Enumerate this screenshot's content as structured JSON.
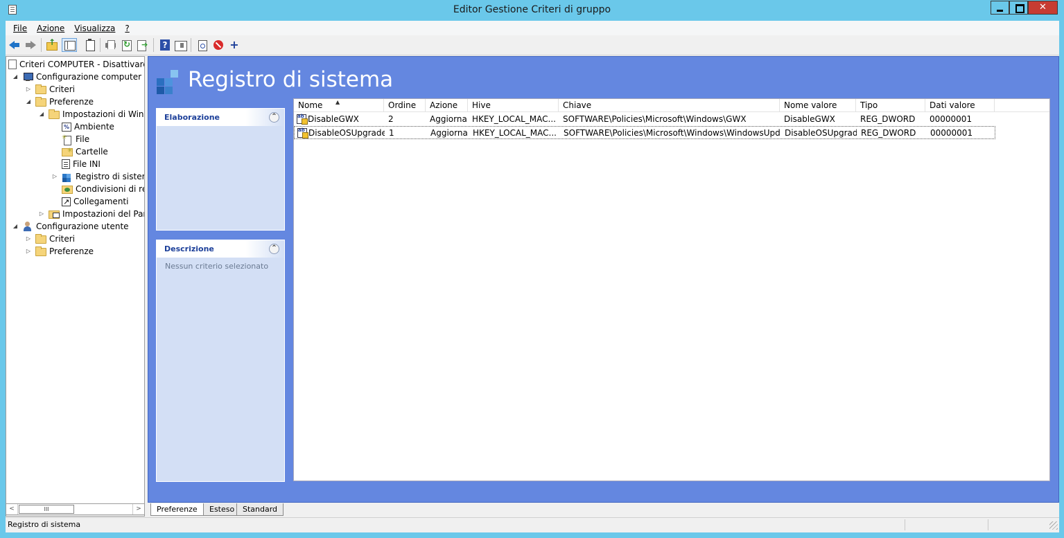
{
  "window": {
    "title": "Editor Gestione Criteri di gruppo"
  },
  "menu": {
    "items": [
      "File",
      "Azione",
      "Visualizza",
      "?"
    ]
  },
  "toolbar": {
    "icons": [
      "back-arrow",
      "forward-arrow",
      "folder-up",
      "show-tree",
      "clipboard",
      "print",
      "refresh",
      "export-list",
      "help",
      "action-pane",
      "new-item",
      "stop",
      "add"
    ]
  },
  "tree": {
    "items": [
      {
        "label": "Criteri COMPUTER - Disattivare I",
        "icon": "policy-doc"
      },
      {
        "label": "Configurazione computer",
        "icon": "computer"
      },
      {
        "label": "Criteri",
        "icon": "folder"
      },
      {
        "label": "Preferenze",
        "icon": "folder"
      },
      {
        "label": "Impostazioni di Windo",
        "icon": "folder"
      },
      {
        "label": "Ambiente",
        "icon": "environment"
      },
      {
        "label": "File",
        "icon": "file"
      },
      {
        "label": "Cartelle",
        "icon": "folder-new"
      },
      {
        "label": "File INI",
        "icon": "ini-file"
      },
      {
        "label": "Registro di sistema",
        "icon": "registry"
      },
      {
        "label": "Condivisioni di ret",
        "icon": "network-share"
      },
      {
        "label": "Collegamenti",
        "icon": "shortcut"
      },
      {
        "label": "Impostazioni del Panr",
        "icon": "control-panel"
      },
      {
        "label": "Configurazione utente",
        "icon": "user"
      },
      {
        "label": "Criteri",
        "icon": "folder"
      },
      {
        "label": "Preferenze",
        "icon": "folder"
      }
    ]
  },
  "main": {
    "title": "Registro di sistema",
    "elaborazione_label": "Elaborazione",
    "descrizione_label": "Descrizione",
    "descrizione_text": "Nessun criterio selezionato"
  },
  "list": {
    "columns": [
      "Nome",
      "Ordine",
      "Azione",
      "Hive",
      "Chiave",
      "Nome valore",
      "Tipo",
      "Dati valore"
    ],
    "rows": [
      {
        "nome": "DisableGWX",
        "ordine": "2",
        "azione": "Aggiorna",
        "hive": "HKEY_LOCAL_MAC...",
        "chiave": "SOFTWARE\\Policies\\Microsoft\\Windows\\GWX",
        "nome_valore": "DisableGWX",
        "tipo": "REG_DWORD",
        "dati": "00000001"
      },
      {
        "nome": "DisableOSUpgrade",
        "ordine": "1",
        "azione": "Aggiorna",
        "hive": "HKEY_LOCAL_MAC...",
        "chiave": "SOFTWARE\\Policies\\Microsoft\\Windows\\WindowsUpdate",
        "nome_valore": "DisableOSUpgrade",
        "tipo": "REG_DWORD",
        "dati": "00000001"
      }
    ]
  },
  "tabs": [
    "Preferenze",
    "Esteso",
    "Standard"
  ],
  "status": {
    "text": "Registro di sistema"
  },
  "colors": {
    "titlebar": "#6ac8ea",
    "main_background": "#6487e0",
    "panel_header_text": "#1c3f99",
    "close_button": "#c73c32"
  }
}
